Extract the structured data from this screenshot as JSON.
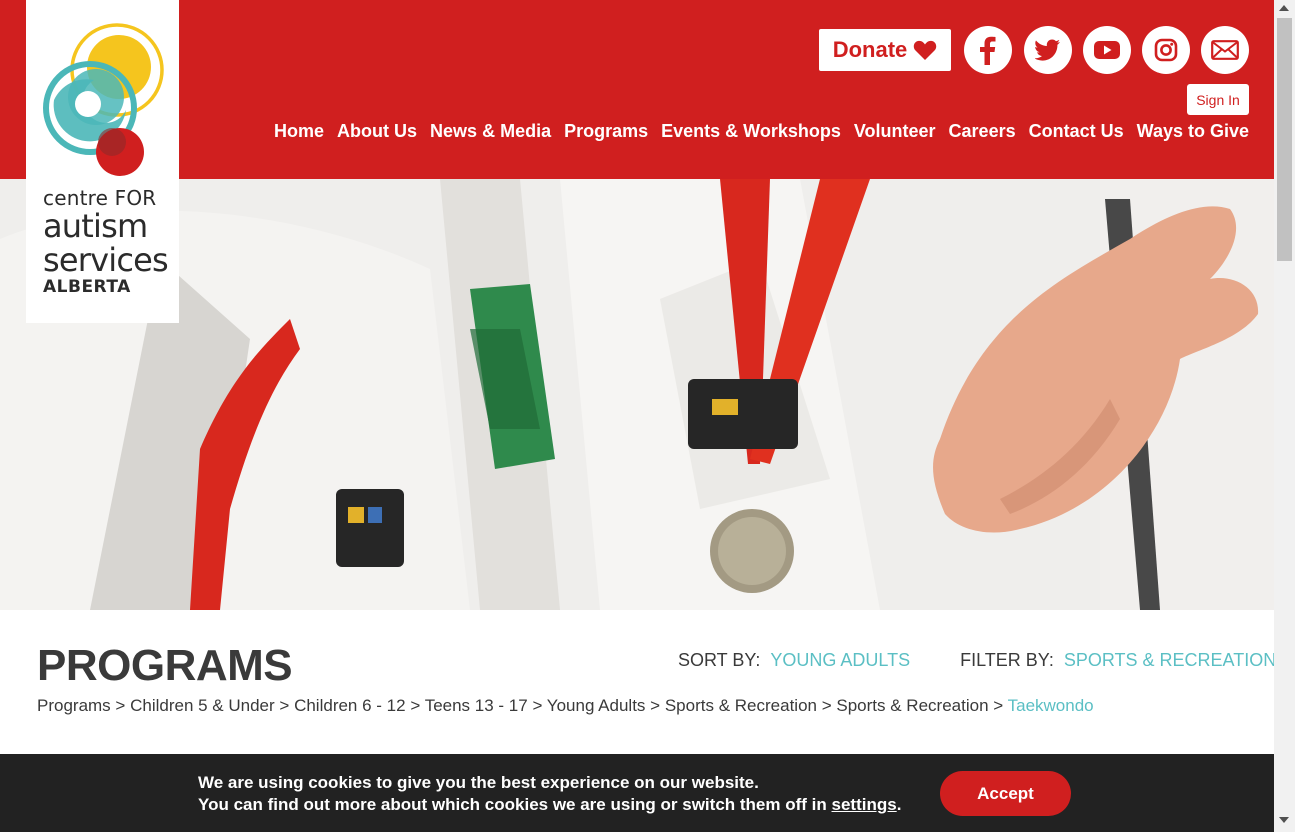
{
  "logo": {
    "line1": "centre FOR",
    "line2": "autism",
    "line3": "services",
    "line4": "ALBERTA",
    "colors": {
      "yellow": "#f5c51e",
      "teal": "#4bb7b8",
      "red": "#d01f1f"
    }
  },
  "header": {
    "donate_label": "Donate",
    "donate_icon": "heart-icon",
    "sign_in_label": "Sign In",
    "social_icons": [
      "facebook-icon",
      "twitter-icon",
      "youtube-icon",
      "instagram-icon",
      "email-icon"
    ],
    "nav": [
      "Home",
      "About Us",
      "News & Media",
      "Programs",
      "Events & Workshops",
      "Volunteer",
      "Careers",
      "Contact Us",
      "Ways to Give"
    ]
  },
  "page": {
    "title": "PROGRAMS",
    "sort_label": "SORT BY:",
    "sort_value": "YOUNG ADULTS",
    "filter_label": "FILTER BY:",
    "filter_value": "SPORTS & RECREATION"
  },
  "breadcrumb": {
    "items": [
      "Programs",
      "Children 5 & Under",
      "Children 6 - 12",
      "Teens 13 - 17",
      "Young Adults",
      "Sports & Recreation",
      "Sports & Recreation"
    ],
    "separator": ">",
    "current": "Taekwondo"
  },
  "cookie": {
    "line1": "We are using cookies to give you the best experience on our website.",
    "line2_prefix": "You can find out more about which cookies we are using or switch them off in",
    "settings_link": "settings",
    "line2_suffix": ".",
    "accept_label": "Accept"
  },
  "colors": {
    "brand_red": "#d01f1f",
    "teal": "#5bbfc4",
    "dark_text": "#3a3a3a",
    "cookie_bg": "#222222"
  }
}
